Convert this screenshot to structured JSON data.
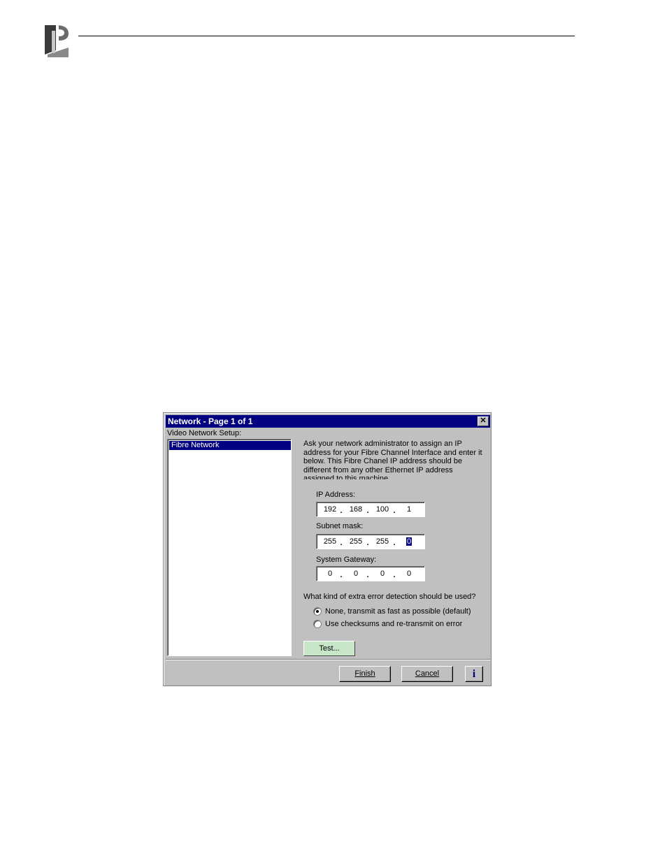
{
  "dialog": {
    "title": "Network - Page 1 of 1",
    "close_glyph": "✕",
    "setup_label": "Video Network Setup:",
    "list_items": [
      "Fibre Network"
    ],
    "intro_text": "Ask your network administrator to assign an IP address for your Fibre Channel Interface and enter it below. This Fibre Chanel IP address should be different from any other Ethernet IP address assigned to this machine.",
    "ip": {
      "label": "IP Address:",
      "octets": [
        "192",
        "168",
        "100",
        "1"
      ]
    },
    "subnet": {
      "label": "Subnet mask:",
      "octets": [
        "255",
        "255",
        "255",
        "0"
      ]
    },
    "gateway": {
      "label": "System Gateway:",
      "octets": [
        "0",
        "0",
        "0",
        "0"
      ]
    },
    "question": "What kind of extra error detection should be used?",
    "options": [
      {
        "label": "None, transmit as fast as possible (default)",
        "selected": true
      },
      {
        "label": "Use checksums and re-transmit on error",
        "selected": false
      }
    ],
    "test_label": "Test...",
    "finish_label": "Finish",
    "cancel_label": "Cancel",
    "info_label": "i"
  },
  "colors": {
    "title_bar": "#000080",
    "dialog_face": "#c0c0c0",
    "test_button": "#c8e6c8"
  },
  "icons": {
    "logo": "company-logo-icon",
    "close": "close-icon",
    "info": "info-icon"
  }
}
